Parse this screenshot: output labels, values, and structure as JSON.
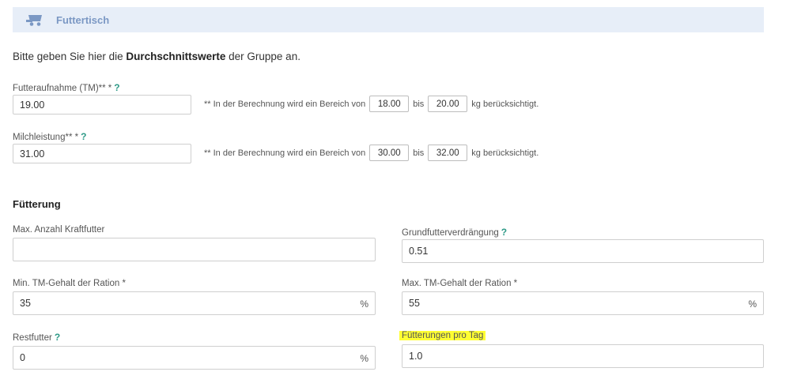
{
  "header": {
    "title": "Futtertisch",
    "icon": "feeding-wagon-icon"
  },
  "intro": {
    "prefix": "Bitte geben Sie hier die ",
    "bold": "Durchschnittswerte",
    "suffix": " der Gruppe an."
  },
  "futteraufnahme": {
    "label": "Futteraufnahme (TM)** *",
    "help": "?",
    "value": "19.00",
    "range_prefix": "** In der Berechnung wird ein Bereich von",
    "range_from": "18.00",
    "range_mid": "bis",
    "range_to": "20.00",
    "range_suffix": "kg berücksichtigt."
  },
  "milchleistung": {
    "label": "Milchleistung** *",
    "help": "?",
    "value": "31.00",
    "range_prefix": "** In der Berechnung wird ein Bereich von",
    "range_from": "30.00",
    "range_mid": "bis",
    "range_to": "32.00",
    "range_suffix": "kg berücksichtigt."
  },
  "fuetterung": {
    "title": "Fütterung",
    "max_kraftfutter": {
      "label": "Max. Anzahl Kraftfutter",
      "value": ""
    },
    "grundfutterverdraengung": {
      "label": "Grundfutterverdrängung",
      "help": "?",
      "value": "0.51"
    },
    "min_tm": {
      "label": "Min. TM-Gehalt der Ration *",
      "value": "35",
      "unit": "%"
    },
    "max_tm": {
      "label": "Max. TM-Gehalt der Ration *",
      "value": "55",
      "unit": "%"
    },
    "restfutter": {
      "label": "Restfutter",
      "help": "?",
      "value": "0",
      "unit": "%"
    },
    "fuetterungen_pro_tag": {
      "label": "Fütterungen pro Tag",
      "value": "1.0",
      "label_highlight": "#ffff33"
    }
  },
  "colors": {
    "header_bg": "#e7eef8",
    "header_text": "#7b98c4",
    "help": "#2e9a87",
    "highlight": "#ffff33"
  }
}
